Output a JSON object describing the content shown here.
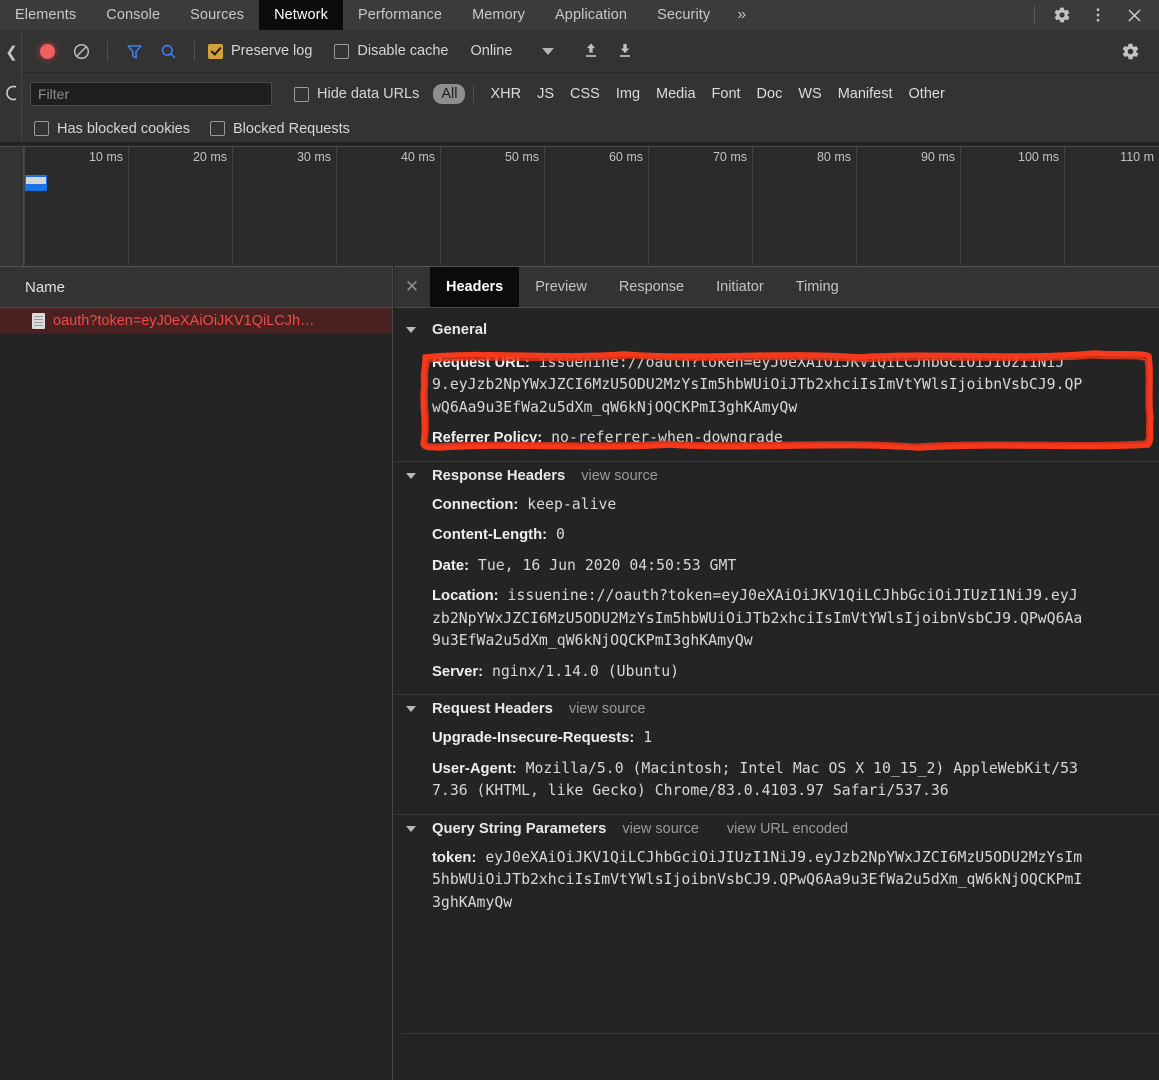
{
  "devtools": {
    "tabs": [
      {
        "label": "Elements",
        "active": false
      },
      {
        "label": "Console",
        "active": false
      },
      {
        "label": "Sources",
        "active": false
      },
      {
        "label": "Network",
        "active": true
      },
      {
        "label": "Performance",
        "active": false
      },
      {
        "label": "Memory",
        "active": false
      },
      {
        "label": "Application",
        "active": false
      },
      {
        "label": "Security",
        "active": false
      }
    ],
    "more_tabs_label": "»",
    "window_icons": [
      "gear-icon",
      "more-vertical-icon",
      "close-icon"
    ]
  },
  "toolbar": {
    "record_title": "record-button",
    "clear_title": "clear-button",
    "filter_title": "filter-toggle",
    "search_title": "search-toggle",
    "preserve_log_label": "Preserve log",
    "preserve_log_checked": true,
    "disable_cache_label": "Disable cache",
    "disable_cache_checked": false,
    "throttle_value": "Online",
    "import_title": "import-har",
    "export_title": "export-har",
    "settings_title": "network-settings"
  },
  "filterbar": {
    "filter_placeholder": "Filter",
    "filter_value": "",
    "hide_data_urls_label": "Hide data URLs",
    "hide_data_urls_checked": false,
    "types": [
      {
        "label": "All",
        "selected": true
      },
      {
        "label": "XHR",
        "selected": false
      },
      {
        "label": "JS",
        "selected": false
      },
      {
        "label": "CSS",
        "selected": false
      },
      {
        "label": "Img",
        "selected": false
      },
      {
        "label": "Media",
        "selected": false
      },
      {
        "label": "Font",
        "selected": false
      },
      {
        "label": "Doc",
        "selected": false
      },
      {
        "label": "WS",
        "selected": false
      },
      {
        "label": "Manifest",
        "selected": false
      },
      {
        "label": "Other",
        "selected": false
      }
    ],
    "has_blocked_cookies_label": "Has blocked cookies",
    "has_blocked_cookies_checked": false,
    "blocked_requests_label": "Blocked Requests",
    "blocked_requests_checked": false
  },
  "overview": {
    "ticks": [
      "10 ms",
      "20 ms",
      "30 ms",
      "40 ms",
      "50 ms",
      "60 ms",
      "70 ms",
      "80 ms",
      "90 ms",
      "100 ms",
      "110 m"
    ]
  },
  "requests": {
    "column_header": "Name",
    "rows": [
      {
        "name": "oauth?token=eyJ0eXAiOiJKV1QiLCJh…",
        "status": "error"
      }
    ]
  },
  "details": {
    "tabs": [
      {
        "label": "Headers",
        "active": true
      },
      {
        "label": "Preview",
        "active": false
      },
      {
        "label": "Response",
        "active": false
      },
      {
        "label": "Initiator",
        "active": false
      },
      {
        "label": "Timing",
        "active": false
      }
    ],
    "sections": [
      {
        "title": "General",
        "view_source": "",
        "view_url_encoded": "",
        "items": [
          {
            "key": "Request URL:",
            "lines": [
              "issuenine://oauth?token=eyJ0eXAiOiJKV1QiLCJhbGciOiJIUzI1NiJ",
              "9.eyJzb2NpYWxJZCI6MzU5ODU2MzYsIm5hbWUiOiJTb2xhciIsImVtYWlsIjoibnVsbCJ9.QP",
              "wQ6Aa9u3EfWa2u5dXm_qW6kNjOQCKPmI3ghKAmyQw"
            ],
            "highlighted": true
          },
          {
            "key": "Referrer Policy:",
            "lines": [
              "no-referrer-when-downgrade"
            ],
            "highlighted": false
          }
        ]
      },
      {
        "title": "Response Headers",
        "view_source": "view source",
        "view_url_encoded": "",
        "items": [
          {
            "key": "Connection:",
            "lines": [
              "keep-alive"
            ],
            "highlighted": false
          },
          {
            "key": "Content-Length:",
            "lines": [
              "0"
            ],
            "highlighted": false
          },
          {
            "key": "Date:",
            "lines": [
              "Tue, 16 Jun 2020 04:50:53 GMT"
            ],
            "highlighted": false
          },
          {
            "key": "Location:",
            "lines": [
              "issuenine://oauth?token=eyJ0eXAiOiJKV1QiLCJhbGciOiJIUzI1NiJ9.eyJ",
              "zb2NpYWxJZCI6MzU5ODU2MzYsIm5hbWUiOiJTb2xhciIsImVtYWlsIjoibnVsbCJ9.QPwQ6Aa",
              "9u3EfWa2u5dXm_qW6kNjOQCKPmI3ghKAmyQw"
            ],
            "highlighted": false
          },
          {
            "key": "Server:",
            "lines": [
              "nginx/1.14.0 (Ubuntu)"
            ],
            "highlighted": false
          }
        ]
      },
      {
        "title": "Request Headers",
        "view_source": "view source",
        "view_url_encoded": "",
        "items": [
          {
            "key": "Upgrade-Insecure-Requests:",
            "lines": [
              "1"
            ],
            "highlighted": false
          },
          {
            "key": "User-Agent:",
            "lines": [
              "Mozilla/5.0 (Macintosh; Intel Mac OS X 10_15_2) AppleWebKit/53",
              "7.36 (KHTML, like Gecko) Chrome/83.0.4103.97 Safari/537.36"
            ],
            "highlighted": false
          }
        ]
      },
      {
        "title": "Query String Parameters",
        "view_source": "view source",
        "view_url_encoded": "view URL encoded",
        "items": [
          {
            "key": "token:",
            "lines": [
              "eyJ0eXAiOiJKV1QiLCJhbGciOiJIUzI1NiJ9.eyJzb2NpYWxJZCI6MzU5ODU2MzYsIm",
              "5hbWUiOiJTb2xhciIsImVtYWlsIjoibnVsbCJ9.QPwQ6Aa9u3EfWa2u5dXm_qW6kNjOQCKPmI",
              "3ghKAmyQw"
            ],
            "highlighted": false
          }
        ]
      }
    ]
  },
  "colors": {
    "accent_blue": "#1a73e8",
    "record_red": "#f06060",
    "error_red": "#ef4b4b",
    "annotation_red": "#f83a1a",
    "checkbox_amber": "#d4a23c",
    "panel_bg": "#242424",
    "toolbar_bg": "#333333"
  }
}
